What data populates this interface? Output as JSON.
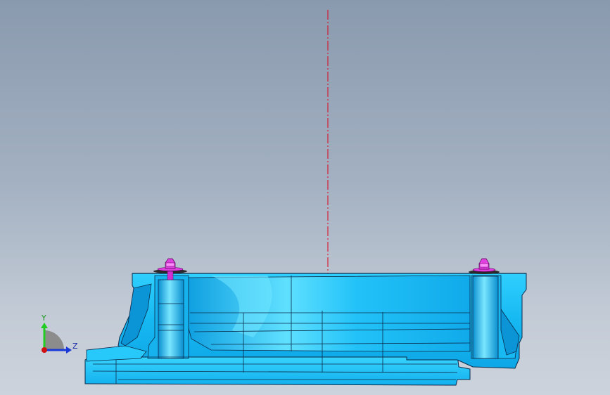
{
  "viewport": {
    "background_top": "#8a9aae",
    "background_bottom": "#cdd3dc"
  },
  "model": {
    "body_color": "#1ec0f5",
    "body_highlight": "#5fdcff",
    "body_shadow": "#0a8fd0",
    "edge_color": "#0b2a4a",
    "fastener_color": "#e040e0",
    "centerline_color": "#e0001a"
  },
  "triad": {
    "y_label": "Y",
    "z_label": "Z",
    "y_color": "#22cc22",
    "z_color": "#1a3ad8",
    "x_color": "#d01010"
  }
}
